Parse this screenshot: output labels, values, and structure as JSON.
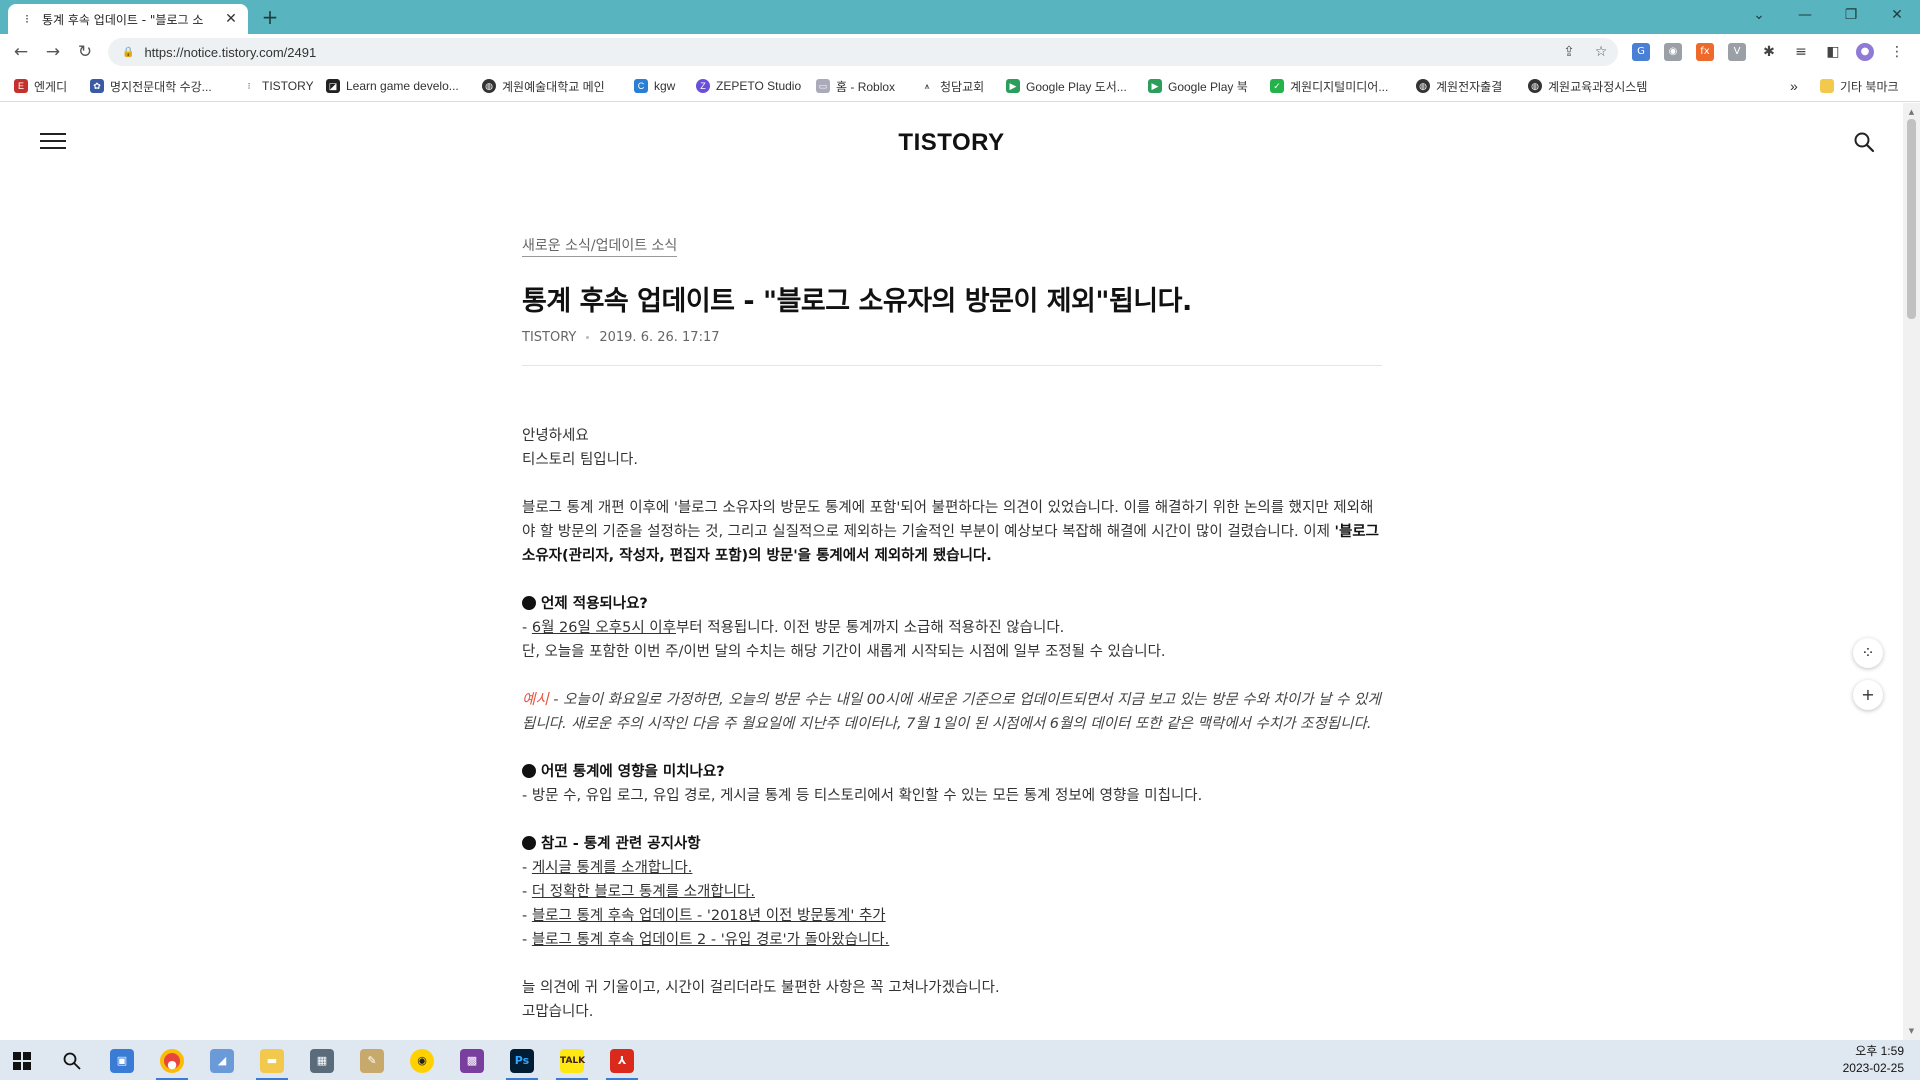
{
  "browser": {
    "tab_title": "통계 후속 업데이트 - \"블로그 소",
    "url": "https://notice.tistory.com/2491",
    "bookmarks": [
      "엔게디",
      "명지전문대학 수강...",
      "TISTORY",
      "Learn game develo...",
      "계원예술대학교 메인",
      "kgw",
      "ZEPETO Studio",
      "홈 - Roblox",
      "청담교회",
      "Google Play 도서...",
      "Google Play 북",
      "계원디지털미디어...",
      "계원전자출결",
      "계원교육과정시스템"
    ],
    "bookmarks_overflow": "»",
    "other_bookmarks": "기타 북마크"
  },
  "site": {
    "logo": "TISTORY"
  },
  "article": {
    "category": "새로운 소식/업데이트 소식",
    "title": "통계 후속 업데이트 - \"블로그 소유자의 방문이 제외\"됩니다.",
    "author": "TISTORY",
    "date": "2019. 6. 26. 17:17",
    "greeting1": "안녕하세요",
    "greeting2": "티스토리 팀입니다.",
    "para1": "블로그 통계 개편 이후에 '블로그 소유자의 방문도 통계에 포함'되어 불편하다는 의견이 있었습니다. 이를 해결하기 위한 논의를 했지만 제외해야 할 방문의 기준을 설정하는 것, 그리고 실질적으로 제외하는 기술적인 부분이 예상보다 복잡해 해결에 시간이 많이 걸렸습니다. 이제 ",
    "para1_bold": "'블로그 소유자(관리자, 작성자, 편집자 포함)의 방문'을 통계에서 제외하게 됐습니다.",
    "s1_heading": "언제 적용되나요?",
    "s1_line1_prefix": "- ",
    "s1_line1_link": "6월 26일 오후5시 이후",
    "s1_line1_rest": "부터 적용됩니다. 이전 방문 통계까지 소급해 적용하진 않습니다.",
    "s1_line2": "단, 오늘을 포함한 이번 주/이번 달의 수치는 해당 기간이 새롭게 시작되는 시점에 일부 조정될 수 있습니다.",
    "example_label": "예시",
    "example_text": " - 오늘이 화요일로 가정하면, 오늘의 방문 수는 내일 00시에 새로운 기준으로 업데이트되면서 지금 보고 있는 방문 수와 차이가 날 수 있게 됩니다. 새로운 주의 시작인 다음 주 월요일에 지난주 데이터나, 7월 1일이 된 시점에서 6월의 데이터 또한 같은 맥락에서 수치가 조정됩니다.",
    "s2_heading": "어떤 통계에 영향을 미치나요?",
    "s2_line": "- 방문 수, 유입 로그, 유입 경로, 게시글 통계 등 티스토리에서 확인할 수 있는 모든 통계 정보에 영향을 미칩니다.",
    "s3_heading": "참고 - 통계 관련 공지사항",
    "links": [
      "게시글 통계를 소개합니다.",
      "더 정확한 블로그 통계를 소개합니다.",
      "블로그 통계 후속 업데이트 - '2018년 이전 방문통계' 추가",
      "블로그 통계 후속 업데이트 2 - '유입 경로'가 돌아왔습니다."
    ],
    "closing1": "늘 의견에 귀 기울이고, 시간이 걸리더라도 불편한 사항은 꼭 고쳐나가겠습니다.",
    "closing2": "고맙습니다."
  },
  "taskbar": {
    "time": "오후 1:59",
    "date": "2023-02-25"
  },
  "colors": {
    "chrome_teal": "#58b4bf",
    "accent_red": "#e8533f",
    "taskbar": "#dfe8f1"
  }
}
